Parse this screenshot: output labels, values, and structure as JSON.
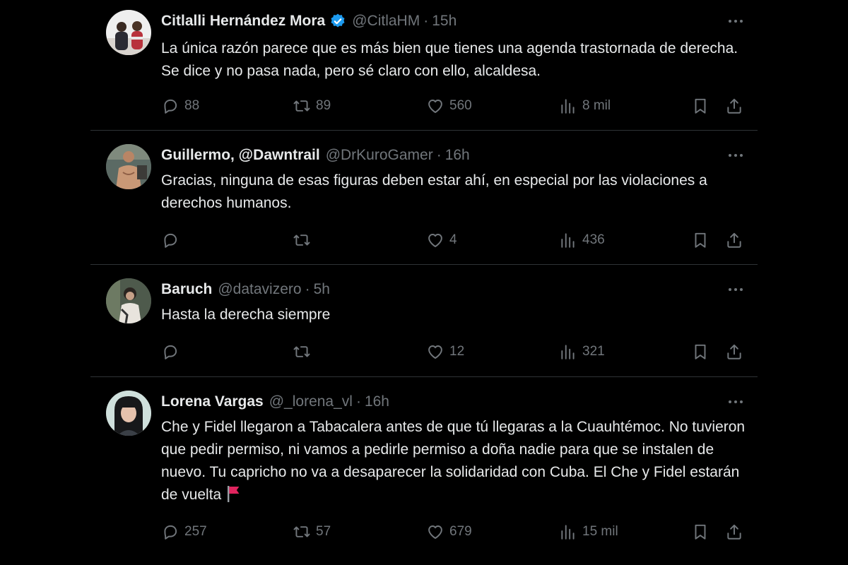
{
  "tweets": [
    {
      "name": "Citlalli Hernández Mora",
      "verified": true,
      "handle": "@CitlaHM",
      "dot": "·",
      "time": "15h",
      "text": "La única razón parece que es más bien que tienes una agenda trastornada de derecha. Se dice y no pasa nada, pero sé claro con ello, alcaldesa.",
      "replies": "88",
      "retweets": "89",
      "likes": "560",
      "views": "8 mil"
    },
    {
      "name": "Guillermo, @Dawntrail",
      "verified": false,
      "handle": "@DrKuroGamer",
      "dot": "·",
      "time": "16h",
      "text": "Gracias, ninguna de esas figuras deben estar ahí, en especial por las violaciones a derechos humanos.",
      "replies": "",
      "retweets": "",
      "likes": "4",
      "views": "436"
    },
    {
      "name": "Baruch",
      "verified": false,
      "handle": "@datavizero",
      "dot": "·",
      "time": "5h",
      "text": "Hasta la derecha siempre",
      "replies": "",
      "retweets": "",
      "likes": "12",
      "views": "321"
    },
    {
      "name": "Lorena Vargas",
      "verified": false,
      "handle": "@_lorena_vl",
      "dot": "·",
      "time": "16h",
      "text": "Che y Fidel llegaron a Tabacalera antes de que tú llegaras a la Cuauhtémoc. No tuvieron que pedir permiso, ni vamos a pedirle permiso a doña nadie para que se instalen de nuevo. Tu capricho no va a desaparecer la solidaridad con Cuba. El Che y Fidel estarán de vuelta",
      "replies": "257",
      "retweets": "57",
      "likes": "679",
      "views": "15 mil"
    }
  ],
  "icons": {
    "reply": "reply-icon",
    "retweet": "retweet-icon",
    "like": "heart-icon",
    "views": "views-icon",
    "bookmark": "bookmark-icon",
    "share": "share-icon",
    "more": "more-icon",
    "verified": "verified-badge-icon",
    "flag": "red-flag-emoji-icon"
  },
  "colors": {
    "background": "#000000",
    "text": "#e7e9ea",
    "muted": "#71767b",
    "divider": "#2f3336",
    "verified": "#1d9bf0",
    "flag": "#e0245e"
  }
}
